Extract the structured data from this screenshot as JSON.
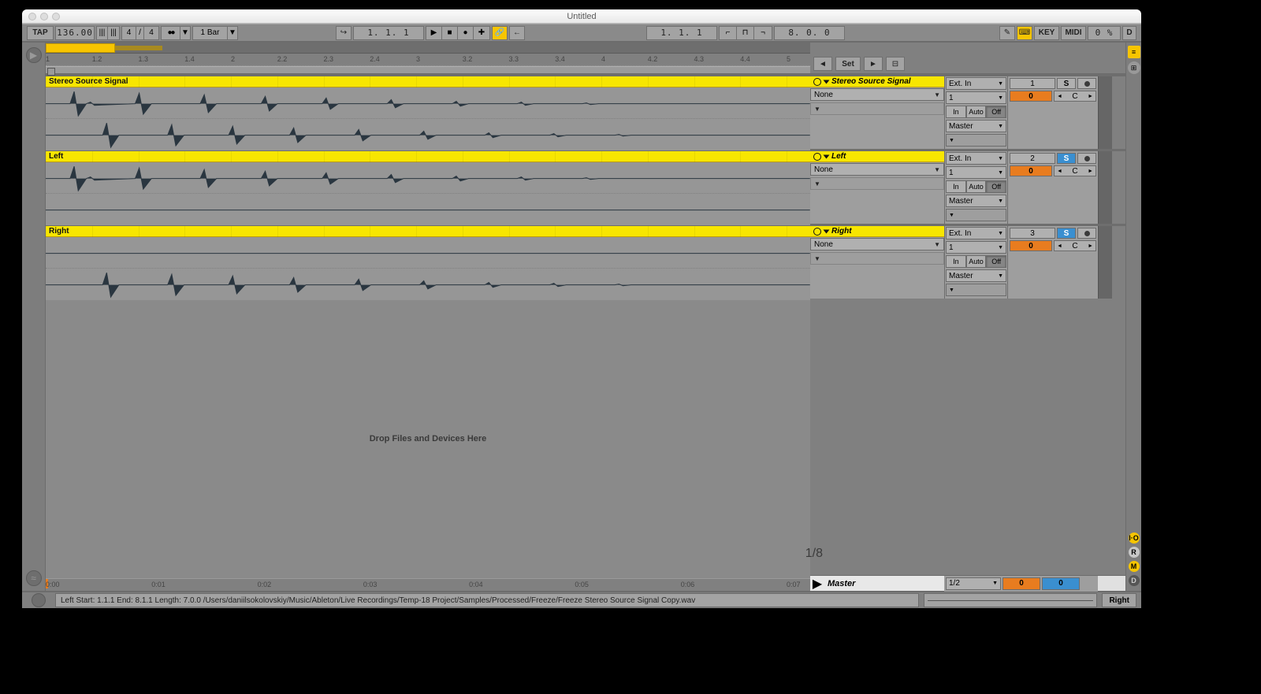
{
  "window": {
    "title": "Untitled"
  },
  "toolbar": {
    "tap": "TAP",
    "tempo": "136.00",
    "time_sig_num": "4",
    "time_sig_den": "4",
    "metronome": "●●",
    "quantize": "1 Bar",
    "transport_position": "1.  1.  1",
    "key_button": "KEY",
    "midi_button": "MIDI",
    "cpu": "0 %",
    "hd": "D",
    "arr_position": "1.  1.  1",
    "loop_length": "8.  0.  0"
  },
  "ruler": {
    "marks": [
      "1",
      "1.2",
      "1.3",
      "1.4",
      "2",
      "2.2",
      "2.3",
      "2.4",
      "3",
      "3.2",
      "3.3",
      "3.4",
      "4",
      "4.2",
      "4.3",
      "4.4",
      "5"
    ]
  },
  "time_ruler": {
    "marks": [
      "0:00",
      "0:01",
      "0:02",
      "0:03",
      "0:04",
      "0:05",
      "0:06",
      "0:07"
    ]
  },
  "tracks": [
    {
      "name": "Stereo Source Signal",
      "type": "stereo",
      "io": {
        "audio_from": "Ext. In",
        "channel": "1",
        "monitor": "Off",
        "audio_to": "Master",
        "routing": "None"
      },
      "mixer": {
        "num": "1",
        "solo": "S",
        "solo_on": false,
        "send": "0",
        "pan": "C"
      }
    },
    {
      "name": "Left",
      "type": "mono",
      "io": {
        "audio_from": "Ext. In",
        "channel": "1",
        "monitor": "Off",
        "audio_to": "Master",
        "routing": "None"
      },
      "mixer": {
        "num": "2",
        "solo": "S",
        "solo_on": true,
        "send": "0",
        "pan": "C"
      }
    },
    {
      "name": "Right",
      "type": "mono",
      "io": {
        "audio_from": "Ext. In",
        "channel": "1",
        "monitor": "Off",
        "audio_to": "Master",
        "routing": "None"
      },
      "mixer": {
        "num": "3",
        "solo": "S",
        "solo_on": true,
        "send": "0",
        "pan": "C"
      }
    }
  ],
  "scrub_bar": {
    "set": "Set"
  },
  "master": {
    "name": "Master",
    "cue": "1/2",
    "vol1": "0",
    "vol2": "0"
  },
  "drop_zone": "Drop Files and Devices Here",
  "zoom": "1/8",
  "status": {
    "info": "Left  Start: 1.1.1  End: 8.1.1  Length: 7.0.0  /Users/daniilsokolovskiy/Music/Ableton/Live Recordings/Temp-18 Project/Samples/Processed/Freeze/Freeze Stereo Source Signal Copy.wav",
    "label": "Right"
  }
}
